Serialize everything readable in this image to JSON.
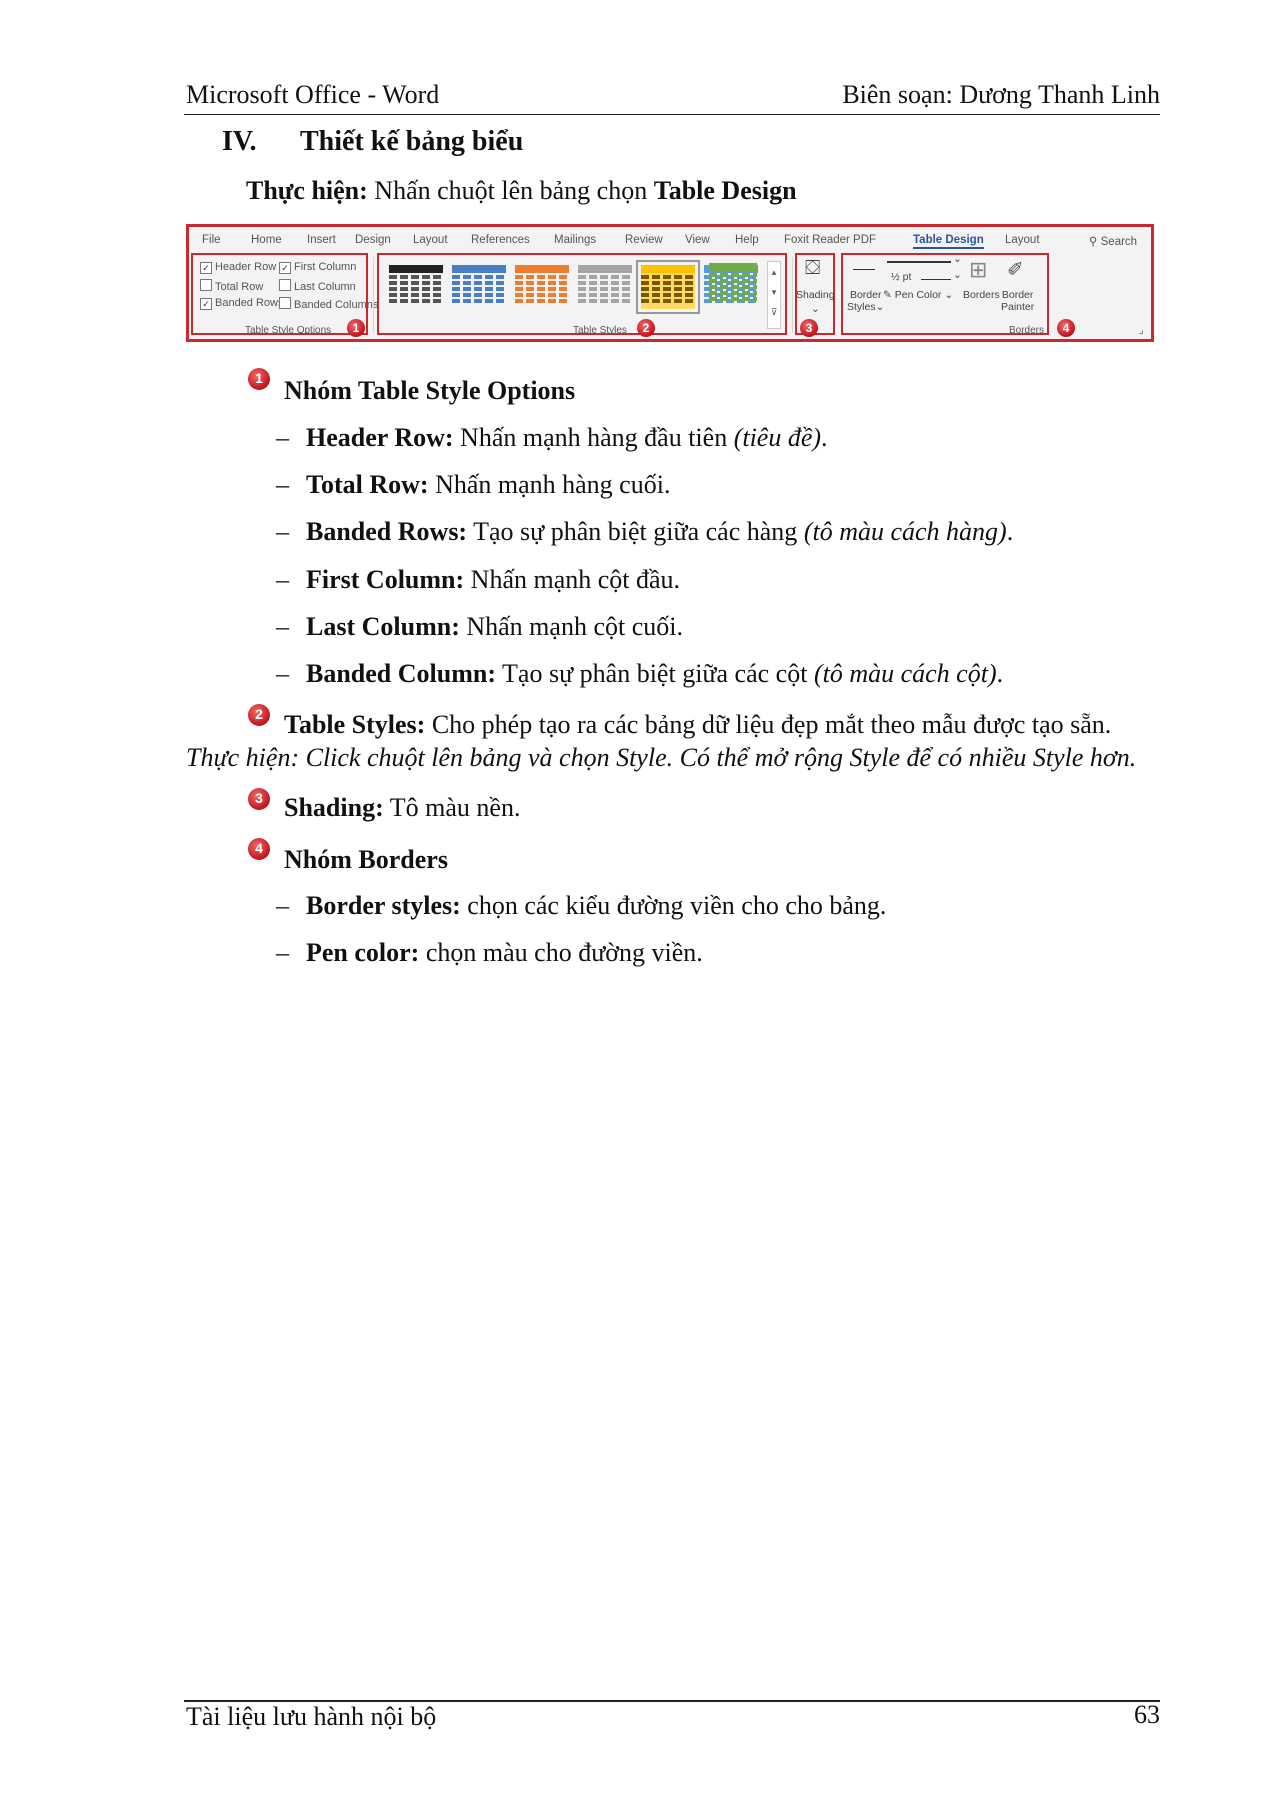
{
  "header": {
    "left": "Microsoft Office - Word",
    "right": "Biên soạn: Dương Thanh Linh"
  },
  "section": {
    "number": "IV.",
    "title": "Thiết kế bảng biểu",
    "intro_label": "Thực hiện:",
    "intro_text": " Nhấn chuột lên bảng chọn ",
    "intro_target": "Table Design"
  },
  "ribbon": {
    "tabs": [
      "File",
      "Home",
      "Insert",
      "Design",
      "Layout",
      "References",
      "Mailings",
      "Review",
      "View",
      "Help",
      "Foxit Reader PDF",
      "Table Design",
      "Layout"
    ],
    "search": "Search",
    "options": [
      "Header Row",
      "First Column",
      "Total Row",
      "Last Column",
      "Banded Rows",
      "Banded Columns"
    ],
    "options_checked": [
      true,
      true,
      false,
      false,
      true,
      false
    ],
    "group1_label": "Table Style Options",
    "group2_label": "Table Styles",
    "group4_label": "Borders",
    "shading_label": "Shading",
    "border_styles_label": [
      "Border",
      "Styles"
    ],
    "pen_weight": "½ pt",
    "pen_color": "Pen Color",
    "borders_label": "Borders",
    "border_painter_label": [
      "Border",
      "Painter"
    ],
    "style_colors": [
      "#222222",
      "#4a7ec6",
      "#ed7d31",
      "#a5a5a5",
      "#ffc000",
      "#5b9bd5",
      "#70ad47"
    ],
    "markers": [
      "1",
      "2",
      "3",
      "4"
    ]
  },
  "items": {
    "g1_marker": "1",
    "g1_title": "Nhóm Table Style Options",
    "g1_list": [
      {
        "label": "Header Row:",
        "text": " Nhấn mạnh hàng đầu tiên ",
        "italic": "(tiêu đề)",
        "end": "."
      },
      {
        "label": "Total Row:",
        "text": " Nhấn mạnh hàng cuối.",
        "italic": "",
        "end": ""
      },
      {
        "label": "Banded Rows:",
        "text": " Tạo sự phân biệt giữa các hàng ",
        "italic": "(tô màu cách hàng)",
        "end": "."
      },
      {
        "label": "First Column:",
        "text": " Nhấn mạnh cột đầu.",
        "italic": "",
        "end": ""
      },
      {
        "label": "Last Column:",
        "text": " Nhấn mạnh cột cuối.",
        "italic": "",
        "end": ""
      },
      {
        "label": "Banded Column:",
        "text": " Tạo sự phân biệt giữa các cột ",
        "italic": "(tô màu cách cột)",
        "end": "."
      }
    ],
    "g2_marker": "2",
    "g2_label": "Table Styles:",
    "g2_text": " Cho phép tạo ra các bảng dữ liệu đẹp mắt theo mẫu được tạo sẵn.",
    "g2_note": "Thực hiện: Click chuột lên bảng và chọn Style. Có thể mở rộng Style để có nhiều Style hơn.",
    "g3_marker": "3",
    "g3_label": "Shading:",
    "g3_text": " Tô màu nền.",
    "g4_marker": "4",
    "g4_title": "Nhóm Borders",
    "g4_list": [
      {
        "label": "Border styles:",
        "text": " chọn các kiểu đường viền cho cho bảng."
      },
      {
        "label": "Pen color:",
        "text": " chọn màu cho đường viền."
      }
    ],
    "dash": "–"
  },
  "footer": {
    "left": "Tài liệu lưu hành nội bộ",
    "page": "63"
  }
}
